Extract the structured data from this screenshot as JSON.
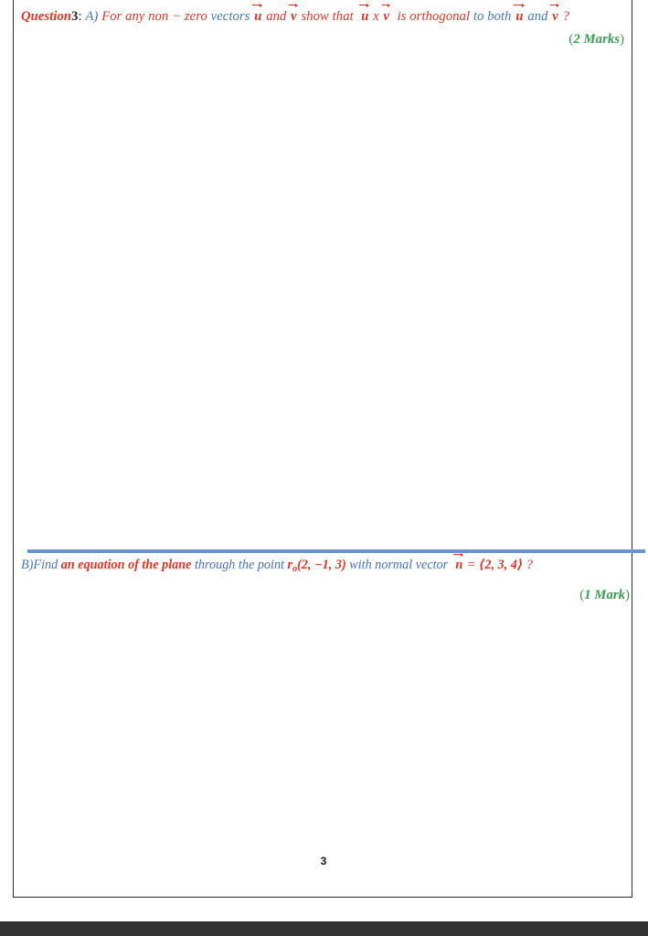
{
  "document": {
    "page_number": "3",
    "colors": {
      "red": "#e03422",
      "blue": "#4472c4",
      "green": "#3c9b53",
      "dark": "#262626",
      "divider": "#6a8fcf",
      "border": "#2b2b2b",
      "bottom_bar": "#333333"
    }
  },
  "question": {
    "label": "Question",
    "number": "3",
    "colon": ":"
  },
  "part_a": {
    "letter": "A)",
    "seg1": "For any non",
    "minus": "−",
    "seg2": "zero",
    "seg3": "vectors",
    "u1": "u",
    "and1": "and",
    "v1": "v",
    "show_that": "show that",
    "u2": "u",
    "cross": "x",
    "v2": "v",
    "orthogonal": "is orthogonal",
    "to_both": "to both",
    "u3": "u",
    "and2": "and",
    "v3": "v",
    "qmark": "?",
    "marks_open": "(",
    "marks_text": "2 Marks",
    "marks_close": ")"
  },
  "part_b": {
    "letter": "B)",
    "find": "Find",
    "emph": "an equation of the plane",
    "through": "through the point",
    "point_symbol": "r",
    "point_sub": "o",
    "point_coords": "(2, −1, 3)",
    "with": "with normal vector",
    "normal_symbol": "n",
    "equals": "=",
    "normal_coords": "⟨2, 3, 4⟩",
    "qmark": "?",
    "marks_open": "(",
    "marks_text": "1 Mark",
    "marks_close": ")"
  }
}
